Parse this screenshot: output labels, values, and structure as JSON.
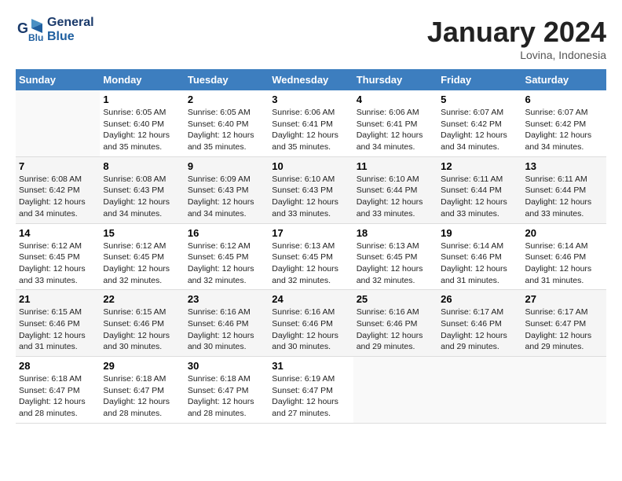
{
  "header": {
    "logo_line1": "General",
    "logo_line2": "Blue",
    "month_title": "January 2024",
    "location": "Lovina, Indonesia"
  },
  "days_of_week": [
    "Sunday",
    "Monday",
    "Tuesday",
    "Wednesday",
    "Thursday",
    "Friday",
    "Saturday"
  ],
  "weeks": [
    [
      {
        "day": "",
        "info": ""
      },
      {
        "day": "1",
        "info": "Sunrise: 6:05 AM\nSunset: 6:40 PM\nDaylight: 12 hours\nand 35 minutes."
      },
      {
        "day": "2",
        "info": "Sunrise: 6:05 AM\nSunset: 6:40 PM\nDaylight: 12 hours\nand 35 minutes."
      },
      {
        "day": "3",
        "info": "Sunrise: 6:06 AM\nSunset: 6:41 PM\nDaylight: 12 hours\nand 35 minutes."
      },
      {
        "day": "4",
        "info": "Sunrise: 6:06 AM\nSunset: 6:41 PM\nDaylight: 12 hours\nand 34 minutes."
      },
      {
        "day": "5",
        "info": "Sunrise: 6:07 AM\nSunset: 6:42 PM\nDaylight: 12 hours\nand 34 minutes."
      },
      {
        "day": "6",
        "info": "Sunrise: 6:07 AM\nSunset: 6:42 PM\nDaylight: 12 hours\nand 34 minutes."
      }
    ],
    [
      {
        "day": "7",
        "info": "Sunrise: 6:08 AM\nSunset: 6:42 PM\nDaylight: 12 hours\nand 34 minutes."
      },
      {
        "day": "8",
        "info": "Sunrise: 6:08 AM\nSunset: 6:43 PM\nDaylight: 12 hours\nand 34 minutes."
      },
      {
        "day": "9",
        "info": "Sunrise: 6:09 AM\nSunset: 6:43 PM\nDaylight: 12 hours\nand 34 minutes."
      },
      {
        "day": "10",
        "info": "Sunrise: 6:10 AM\nSunset: 6:43 PM\nDaylight: 12 hours\nand 33 minutes."
      },
      {
        "day": "11",
        "info": "Sunrise: 6:10 AM\nSunset: 6:44 PM\nDaylight: 12 hours\nand 33 minutes."
      },
      {
        "day": "12",
        "info": "Sunrise: 6:11 AM\nSunset: 6:44 PM\nDaylight: 12 hours\nand 33 minutes."
      },
      {
        "day": "13",
        "info": "Sunrise: 6:11 AM\nSunset: 6:44 PM\nDaylight: 12 hours\nand 33 minutes."
      }
    ],
    [
      {
        "day": "14",
        "info": "Sunrise: 6:12 AM\nSunset: 6:45 PM\nDaylight: 12 hours\nand 33 minutes."
      },
      {
        "day": "15",
        "info": "Sunrise: 6:12 AM\nSunset: 6:45 PM\nDaylight: 12 hours\nand 32 minutes."
      },
      {
        "day": "16",
        "info": "Sunrise: 6:12 AM\nSunset: 6:45 PM\nDaylight: 12 hours\nand 32 minutes."
      },
      {
        "day": "17",
        "info": "Sunrise: 6:13 AM\nSunset: 6:45 PM\nDaylight: 12 hours\nand 32 minutes."
      },
      {
        "day": "18",
        "info": "Sunrise: 6:13 AM\nSunset: 6:45 PM\nDaylight: 12 hours\nand 32 minutes."
      },
      {
        "day": "19",
        "info": "Sunrise: 6:14 AM\nSunset: 6:46 PM\nDaylight: 12 hours\nand 31 minutes."
      },
      {
        "day": "20",
        "info": "Sunrise: 6:14 AM\nSunset: 6:46 PM\nDaylight: 12 hours\nand 31 minutes."
      }
    ],
    [
      {
        "day": "21",
        "info": "Sunrise: 6:15 AM\nSunset: 6:46 PM\nDaylight: 12 hours\nand 31 minutes."
      },
      {
        "day": "22",
        "info": "Sunrise: 6:15 AM\nSunset: 6:46 PM\nDaylight: 12 hours\nand 30 minutes."
      },
      {
        "day": "23",
        "info": "Sunrise: 6:16 AM\nSunset: 6:46 PM\nDaylight: 12 hours\nand 30 minutes."
      },
      {
        "day": "24",
        "info": "Sunrise: 6:16 AM\nSunset: 6:46 PM\nDaylight: 12 hours\nand 30 minutes."
      },
      {
        "day": "25",
        "info": "Sunrise: 6:16 AM\nSunset: 6:46 PM\nDaylight: 12 hours\nand 29 minutes."
      },
      {
        "day": "26",
        "info": "Sunrise: 6:17 AM\nSunset: 6:46 PM\nDaylight: 12 hours\nand 29 minutes."
      },
      {
        "day": "27",
        "info": "Sunrise: 6:17 AM\nSunset: 6:47 PM\nDaylight: 12 hours\nand 29 minutes."
      }
    ],
    [
      {
        "day": "28",
        "info": "Sunrise: 6:18 AM\nSunset: 6:47 PM\nDaylight: 12 hours\nand 28 minutes."
      },
      {
        "day": "29",
        "info": "Sunrise: 6:18 AM\nSunset: 6:47 PM\nDaylight: 12 hours\nand 28 minutes."
      },
      {
        "day": "30",
        "info": "Sunrise: 6:18 AM\nSunset: 6:47 PM\nDaylight: 12 hours\nand 28 minutes."
      },
      {
        "day": "31",
        "info": "Sunrise: 6:19 AM\nSunset: 6:47 PM\nDaylight: 12 hours\nand 27 minutes."
      },
      {
        "day": "",
        "info": ""
      },
      {
        "day": "",
        "info": ""
      },
      {
        "day": "",
        "info": ""
      }
    ]
  ]
}
